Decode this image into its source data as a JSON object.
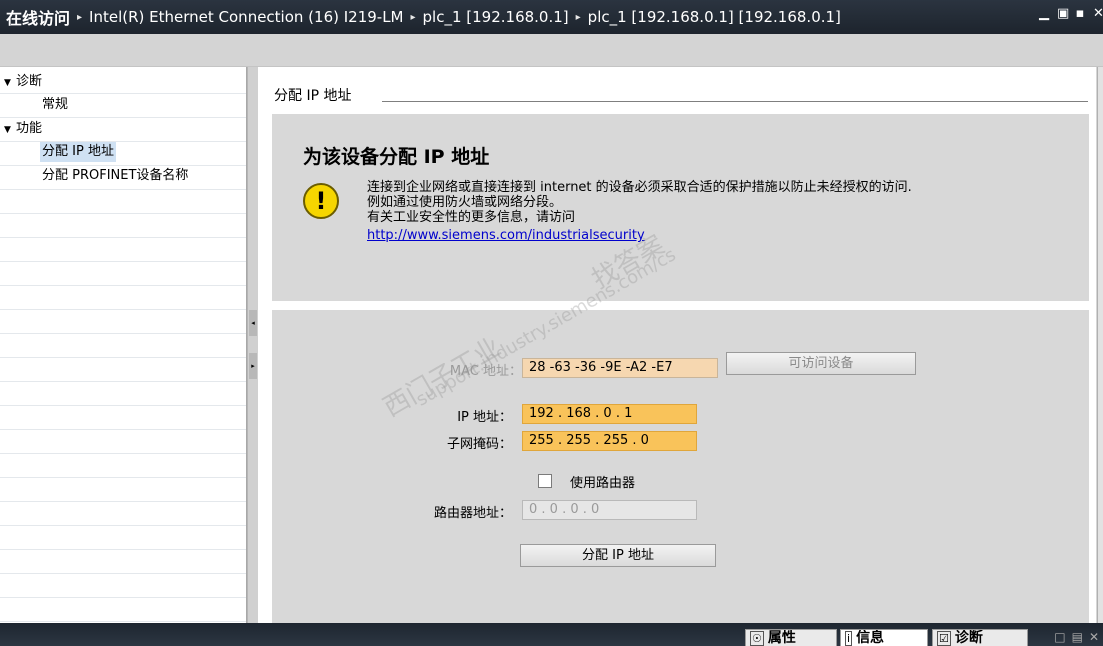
{
  "titlebar": {
    "crumbs": [
      "在线访问",
      "Intel(R) Ethernet Connection (16) I219-LM",
      "plc_1 [192.168.0.1]",
      "plc_1 [192.168.0.1] [192.168.0.1]"
    ],
    "separator": "▸",
    "win_min": "▁",
    "win_restore": "▣",
    "win_max": "▪",
    "win_close": "✕"
  },
  "tree": {
    "items": [
      {
        "label": "诊断",
        "expander": "▼"
      },
      {
        "label": "常规"
      },
      {
        "label": "功能",
        "expander": "▼"
      },
      {
        "label": "分配 IP 地址"
      },
      {
        "label": "分配 PROFINET设备名称"
      }
    ]
  },
  "splitter": {
    "collapse_left": "◂",
    "expand_right": "▸"
  },
  "main": {
    "section_title": "分配 IP 地址",
    "heading": "为该设备分配 IP 地址",
    "warn_symbol": "!",
    "warning_lines": [
      "连接到企业网络或直接连接到 internet 的设备必须采取合适的保护措施以防止未经授权的访问.",
      "例如通过使用防火墙或网络分段。",
      "有关工业安全性的更多信息，请访问"
    ],
    "link": "http://www.siemens.com/industrialsecurity",
    "form": {
      "mac_label": "MAC 地址：",
      "mac_value": "28 -63 -36 -9E -A2 -E7",
      "accessible_devices_button": "可访问设备",
      "ip_label": "IP 地址：",
      "ip_value": "192 . 168 . 0    . 1",
      "subnet_label": "子网掩码：",
      "subnet_value": "255 . 255 . 255 . 0",
      "use_router_label": "使用路由器",
      "use_router_checked": false,
      "router_label": "路由器地址：",
      "router_value": "0    . 0    . 0    . 0",
      "assign_button": "分配 IP 地址"
    }
  },
  "watermark": {
    "line1": "西门子工业",
    "line2": "找答案",
    "line3": "support.industry.siemens.com/cs"
  },
  "bottombar": {
    "tabs": [
      {
        "icon": "☉",
        "label": "属性"
      },
      {
        "icon": "i",
        "label": "信息"
      },
      {
        "icon": "☑",
        "label": "诊断"
      }
    ],
    "icons": [
      "□",
      "▤",
      "✕"
    ]
  },
  "colors": {
    "titlebar_bg": "#232b35",
    "field_orange": "#f9c35a",
    "panel_gray": "#d8d8d8",
    "link_blue": "#0000cc",
    "warn_yellow": "#f6d600"
  }
}
